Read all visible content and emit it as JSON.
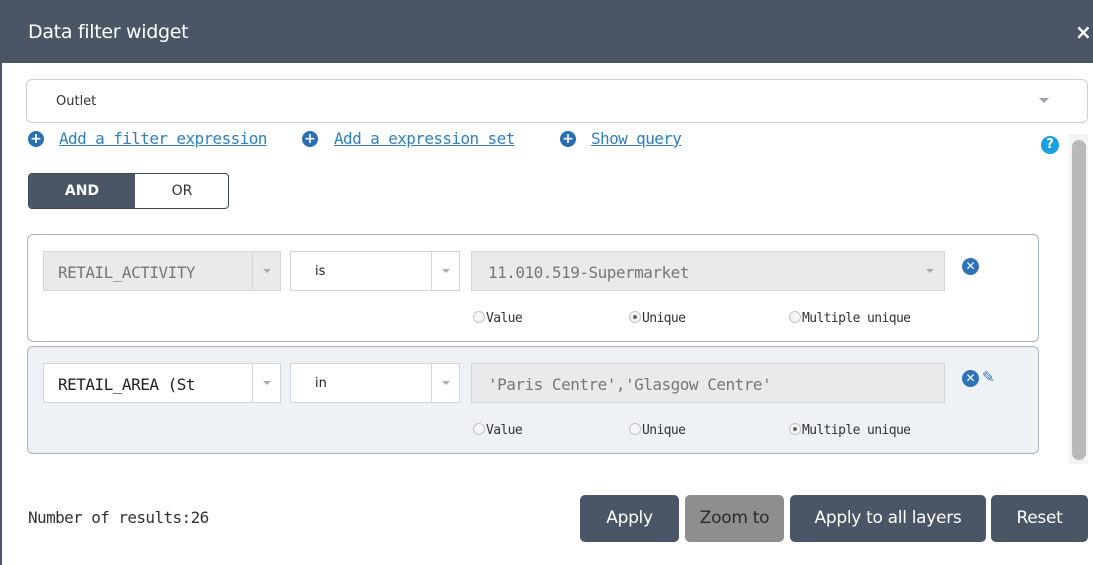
{
  "window": {
    "title": "Data filter widget",
    "close_symbol": "×"
  },
  "layer_select": {
    "value": "Outlet"
  },
  "links": {
    "add_filter": "Add a filter expression",
    "add_set": "Add a expression set",
    "show_query": "Show query"
  },
  "help": {
    "symbol": "?"
  },
  "logic_toggle": {
    "and_label": "AND",
    "or_label": "OR",
    "selected": "AND"
  },
  "expressions": [
    {
      "field": "RETAIL_ACTIVITY",
      "operator": "is",
      "value": "11.010.519-Supermarket",
      "enabled": false,
      "radios": {
        "value": "Value",
        "unique": "Unique",
        "multiple": "Multiple unique",
        "selected": "Unique"
      }
    },
    {
      "field": "RETAIL_AREA (St",
      "operator": "in",
      "value": "'Paris Centre','Glasgow Centre'",
      "enabled": true,
      "radios": {
        "value": "Value",
        "unique": "Unique",
        "multiple": "Multiple unique",
        "selected": "Multiple unique"
      }
    }
  ],
  "results": {
    "text": "Number of results:26"
  },
  "buttons": {
    "apply": "Apply",
    "zoom_to": "Zoom to",
    "apply_all": "Apply to all layers",
    "reset": "Reset"
  },
  "colors": {
    "header": "#4a5566",
    "link": "#2f7fc1",
    "help": "#1a9fe0",
    "zoom_disabled": "#8e8e8e"
  },
  "icons": {
    "close": "close-icon",
    "add": "plus-circle-icon",
    "help": "question-icon",
    "remove": "remove-circle-icon",
    "edit": "pencil-icon"
  }
}
